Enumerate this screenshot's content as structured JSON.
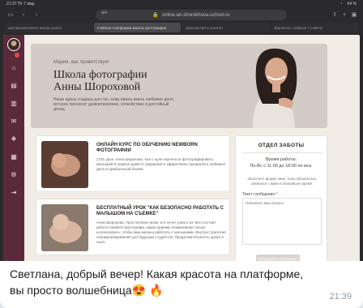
{
  "statusbar": {
    "time": "21:37",
    "date": "Пт 7 мар.",
    "battery": "64 %"
  },
  "browser": {
    "url": "online.an-shorokhova-school.ru",
    "aa": "аА",
    "tabs": [
      "мастерская моего имени рынок",
      "Учебная платформа Школы фотографии",
      "пересмотреть контент",
      "Вероятно: главные 7 советы"
    ]
  },
  "hero": {
    "greeting": "Мария, вас приветствует",
    "title": "Школа фотографии\nАнны Шороховой",
    "subtitle": "Наши курсы созданы для тех, кому важно иметь любимое дело, которое приносит удовлетворение, спокойствие и достойный доход"
  },
  "courses": [
    {
      "title": "ОНЛАЙН КУРС ПО ОБУЧЕНИЮ NEWBORN ФОТОГРАФИИ",
      "text": "1751 урок. Анна Шорохова. Как с нуля научиться фотографировать малышей в первые дней от рождения и эффективно превратить любимое дело в прибыльный бизнес"
    },
    {
      "title": "БЕСПЛАТНЫЙ УРОК \"КАК БЕЗОПАСНО РАБОТАТЬ С МАЛЫШОМ НА СЪЕМКЕ\"",
      "text": "Анна Шорохова. Урок полезен всем, кто хочет узнать из чего состоит работа newborn фотографа, какие приемы позирования лучше использовать, чтобы ваш малыш работать с малышами. Внутри стратегия специализирования для будущих студентов. Продолжительность урока 2 часа."
    }
  ],
  "support": {
    "title": "ОТДЕЛ ЗАБОТЫ",
    "hours_label": "Время работы:",
    "hours": "Пн-Вс с 11:00 до 18:00 по мск.",
    "note": "Заполните форму ниже, и мы обязательно свяжемся с вами в ближайшее время.",
    "field_label": "Текст сообщения",
    "required_mark": "*",
    "placeholder": "Напишите ваш вопрос",
    "button": "Отправить сообщение"
  },
  "chat": {
    "message": "Светлана, добрый вечер! Какая красота на платформе, вы просто волшебница😍 🔥",
    "time": "21:39"
  },
  "colors": {
    "sidebar": "#5b2a3a",
    "page_bg": "#f1ece6",
    "hero_bg": "#d3cbc6"
  }
}
